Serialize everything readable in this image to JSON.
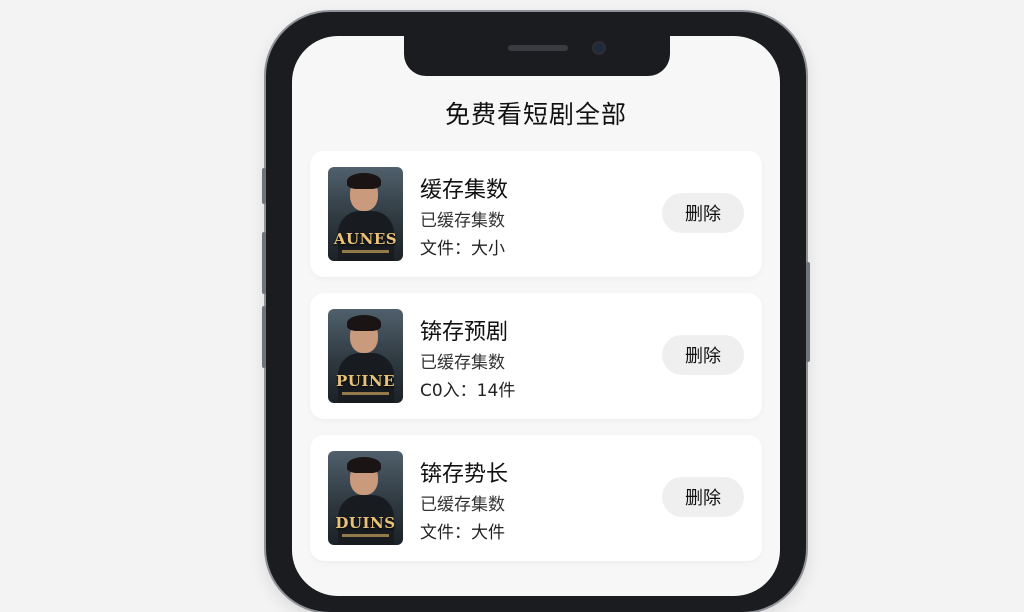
{
  "page_title": "免费看短剧全部",
  "items": [
    {
      "name": "缓存集数",
      "cached": "已缓存集数",
      "size": "文件：大小",
      "poster_text": "AUNES",
      "delete_label": "删除"
    },
    {
      "name": "锛存预剧",
      "cached": "已缓存集数",
      "size": "C0入：14件",
      "poster_text": "PUINE",
      "delete_label": "删除"
    },
    {
      "name": "锛存势长",
      "cached": "已缓存集数",
      "size": "文件：大件",
      "poster_text": "DUINS",
      "delete_label": "删除"
    }
  ]
}
